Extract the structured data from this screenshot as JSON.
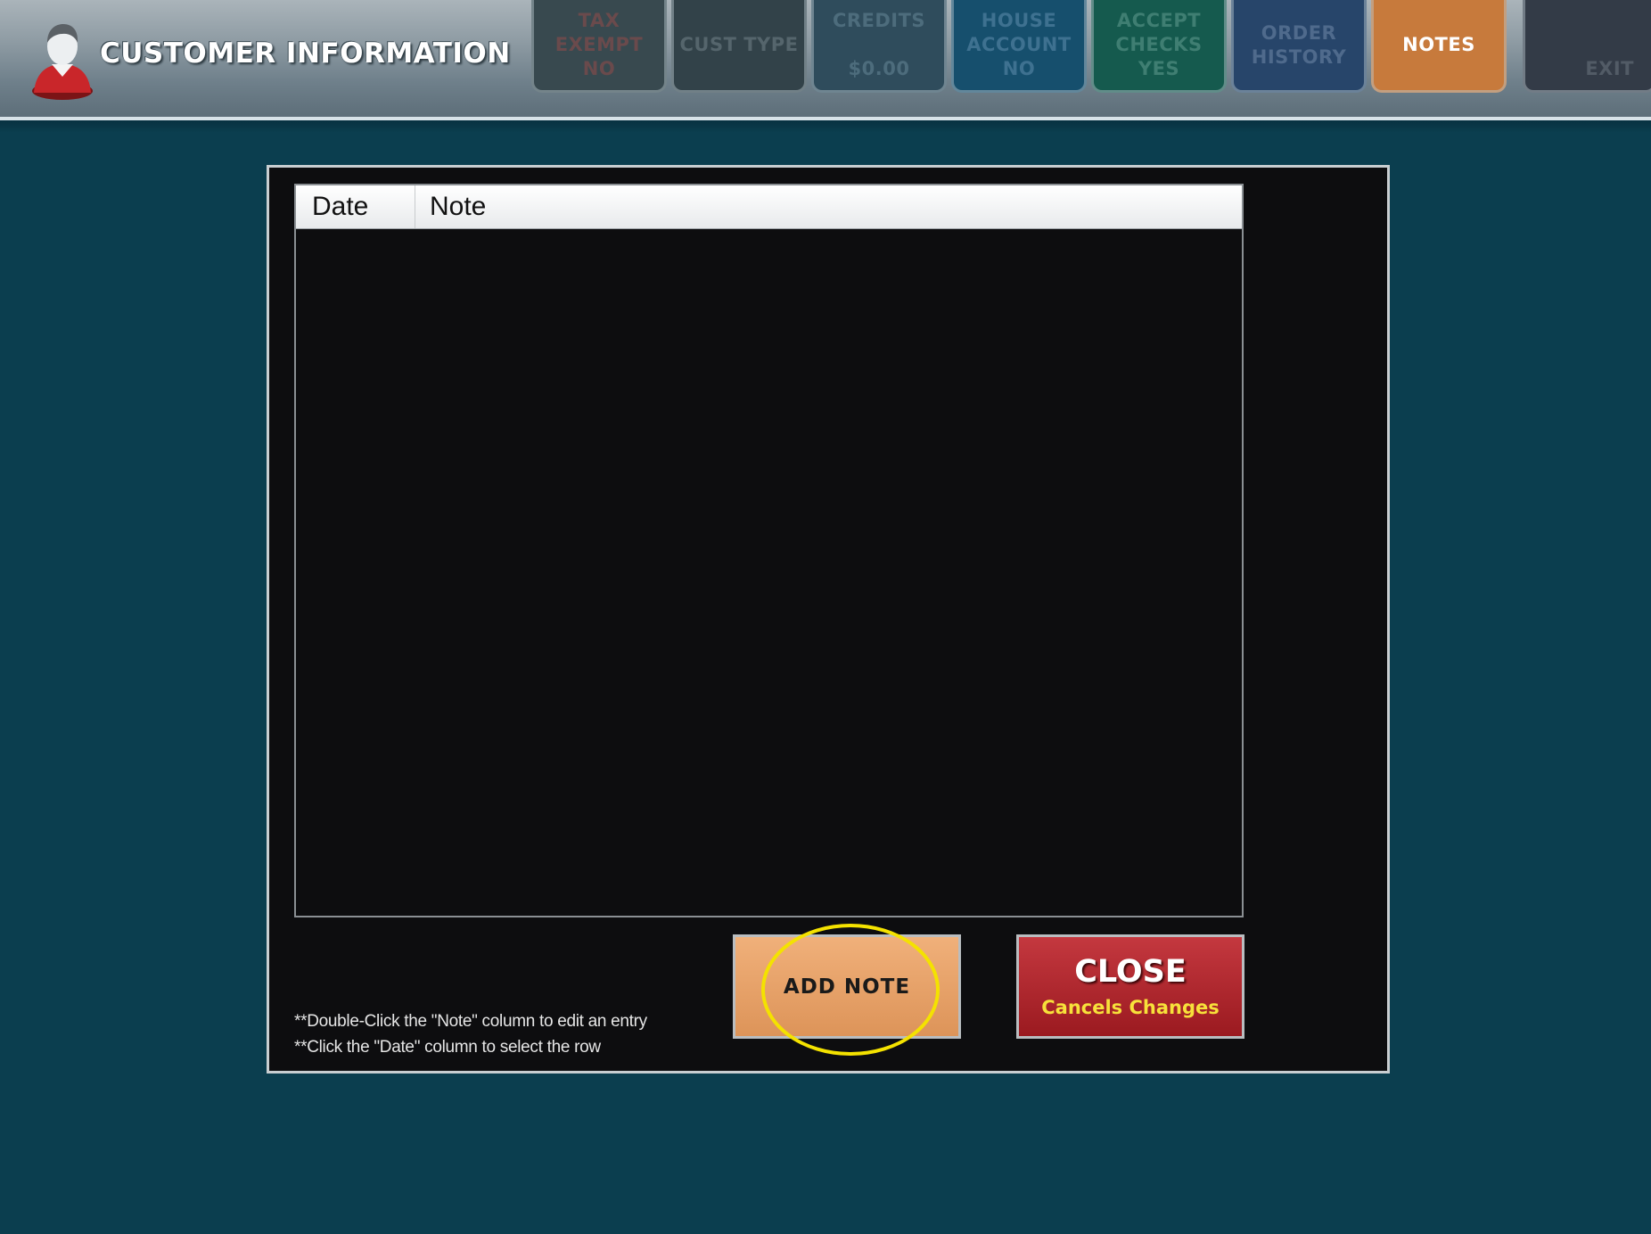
{
  "header": {
    "title": "CUSTOMER INFORMATION",
    "tabs": [
      {
        "id": "tax-exempt",
        "lines": [
          "TAX",
          "EXEMPT",
          "NO"
        ],
        "bg": "#38494f",
        "fg": "#6a4a4c"
      },
      {
        "id": "cust-type",
        "lines": [
          "CUST TYPE"
        ],
        "bg": "#324249",
        "fg": "#55656c"
      },
      {
        "id": "credits",
        "lines": [
          "CREDITS",
          "",
          "$0.00"
        ],
        "bg": "#2f4c5c",
        "fg": "#4d6c7c"
      },
      {
        "id": "house-account",
        "lines": [
          "HOUSE",
          "ACCOUNT",
          "NO"
        ],
        "bg": "#164f6d",
        "fg": "#3e7190"
      },
      {
        "id": "accept-checks",
        "lines": [
          "ACCEPT",
          "CHECKS",
          "YES"
        ],
        "bg": "#155a4e",
        "fg": "#3f7e72"
      },
      {
        "id": "order-history",
        "lines": [
          "ORDER",
          "HISTORY"
        ],
        "bg": "#27456a",
        "fg": "#4f6a8c"
      },
      {
        "id": "notes",
        "lines": [
          "NOTES"
        ],
        "bg": "#c77a3c",
        "fg": "#ffffff"
      },
      {
        "id": "exit",
        "lines": [
          "",
          "",
          "EXIT"
        ],
        "bg": "#333b47",
        "fg": "#525b66"
      }
    ]
  },
  "notes_grid": {
    "columns": [
      "Date",
      "Note"
    ],
    "rows": []
  },
  "buttons": {
    "add_note": "ADD NOTE",
    "close_title": "CLOSE",
    "close_subtitle": "Cancels Changes"
  },
  "hints": [
    "**Double-Click the \"Note\" column to edit an entry",
    "**Click the \"Date\" column to select the row"
  ],
  "colors": {
    "background": "#0b3e4f",
    "panel": "#0d0d0f",
    "add_note_button": "#e8a06b",
    "close_button": "#b02a30",
    "highlight_ring": "#f4e200"
  }
}
